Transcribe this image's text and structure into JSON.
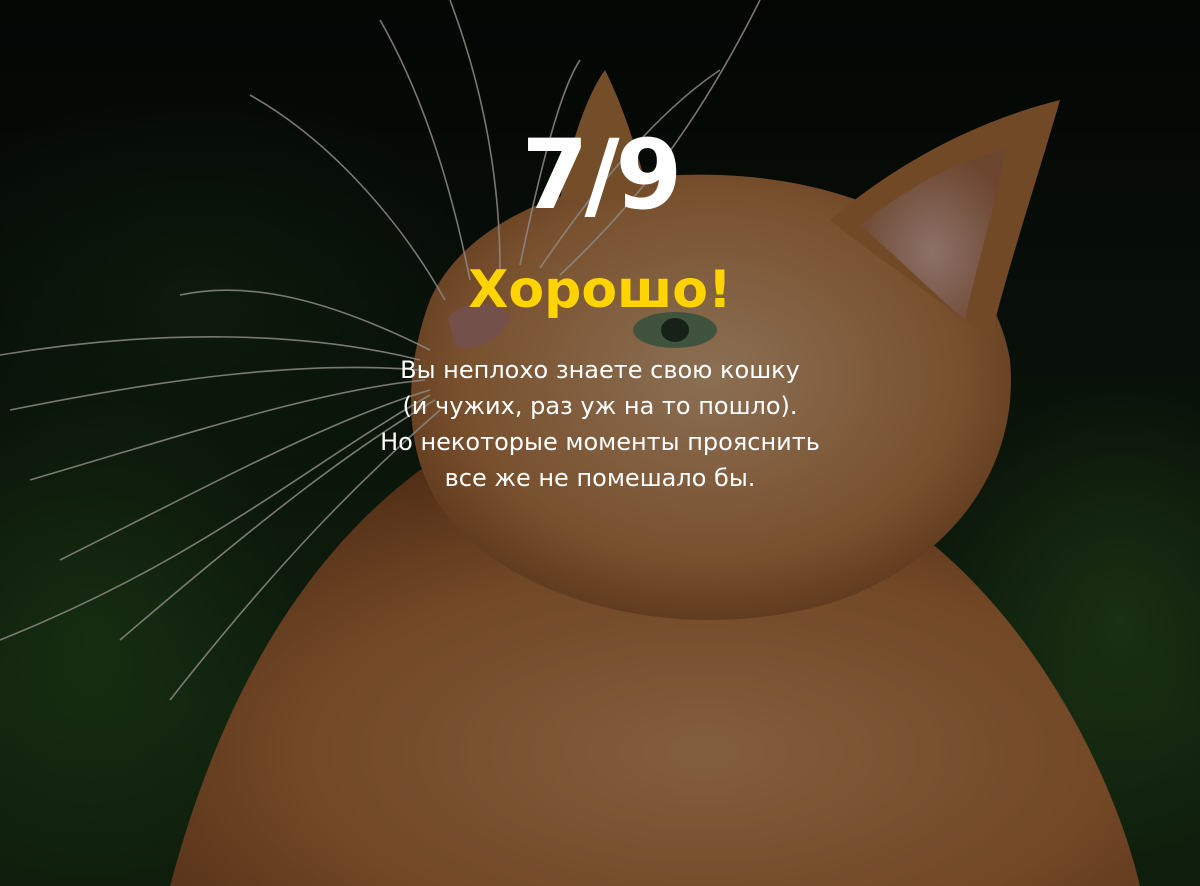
{
  "result": {
    "score": "7/9",
    "verdict": "Хорошо!",
    "description_lines": [
      "Вы неплохо знаете свою кошку",
      "(и чужих, раз уж на то пошло).",
      "Но некоторые моменты прояснить",
      "все же не помешало бы."
    ]
  },
  "colors": {
    "score": "#ffffff",
    "verdict": "#ffd400",
    "description": "#ffffff",
    "overlay": "rgba(0,0,0,0.42)"
  }
}
